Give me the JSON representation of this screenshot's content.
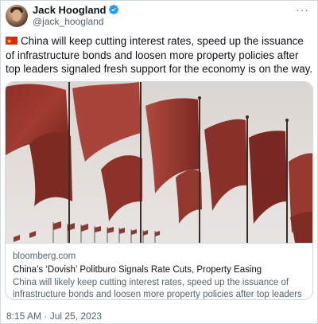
{
  "author": {
    "name": "Jack Hoogland",
    "handle": "@jack_hoogland"
  },
  "more_menu": "···",
  "tweet_text": "China will keep cutting interest rates, speed up the issuance of infrastructure bonds and loosen more property policies after top leaders signaled fresh support for the economy is on the way.",
  "link_card": {
    "domain": "bloomberg.com",
    "title": "China’s ‘Dovish’ Politburo Signals Rate Cuts, Property Easing",
    "description": "China will likely keep cutting interest rates, speed up the issuance of infrastructure bonds and loosen more property policies after top leaders ..."
  },
  "timestamp": "8:15 AM · Jul 25, 2023",
  "colors": {
    "verified_blue": "#1d9bf0",
    "flag_red": "#de2910",
    "flag_star": "#ffde00",
    "secondary_text": "#536471",
    "border": "#cfd9de"
  },
  "icons": {
    "verified": "verified-badge-icon",
    "flag": "china-flag-emoji",
    "more": "more-horizontal-icon"
  }
}
